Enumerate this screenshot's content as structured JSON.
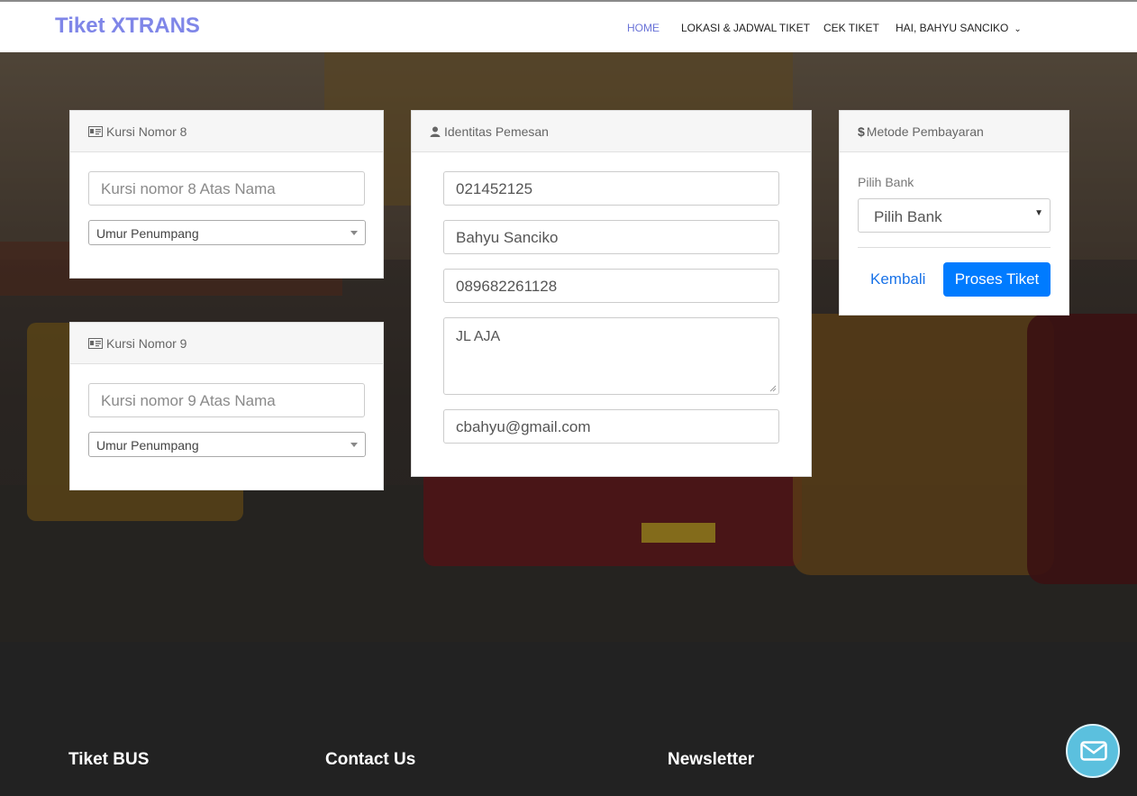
{
  "header": {
    "brand": "Tiket XTRANS",
    "nav": {
      "home": "HOME",
      "lokasi": "LOKASI & JADWAL TIKET",
      "cek": "CEK TIKET",
      "user": "HAI, BAHYU SANCIKO"
    }
  },
  "seat8": {
    "title": "Kursi Nomor 8",
    "name_placeholder": "Kursi nomor 8 Atas Nama",
    "age_select": "Umur Penumpang"
  },
  "seat9": {
    "title": "Kursi Nomor 9",
    "name_placeholder": "Kursi nomor 9 Atas Nama",
    "age_select": "Umur Penumpang"
  },
  "identity": {
    "title": "Identitas Pemesan",
    "ktp": "021452125",
    "name": "Bahyu Sanciko",
    "phone": "089682261128",
    "address": "JL AJA",
    "email": "cbahyu@gmail.com"
  },
  "payment": {
    "title": "Metode Pembayaran",
    "bank_label": "Pilih Bank",
    "bank_select": "Pilih Bank",
    "back": "Kembali",
    "submit": "Proses Tiket"
  },
  "footer": {
    "col1": "Tiket BUS",
    "col2": "Contact Us",
    "col3": "Newsletter"
  },
  "colors": {
    "brand": "#7f86e8",
    "primary": "#007bff",
    "link": "#1a73e8",
    "mail": "#5bc0de"
  }
}
